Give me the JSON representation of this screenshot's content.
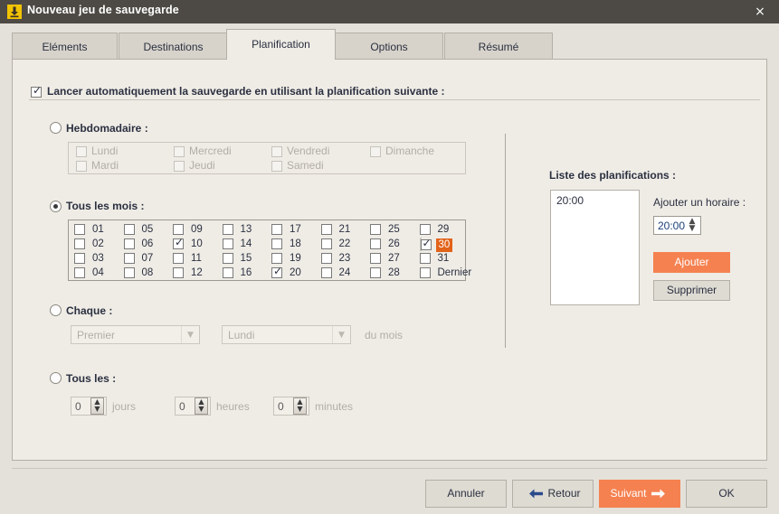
{
  "window": {
    "title": "Nouveau jeu de sauvegarde",
    "icon": "backup-download-icon",
    "close_label": "×",
    "accent_color": "#e2631a",
    "accent_light": "#f58150",
    "titlebar_color": "#4d4a45"
  },
  "tabs": [
    {
      "label": "Eléments",
      "active": false
    },
    {
      "label": "Destinations",
      "active": false
    },
    {
      "label": "Planification",
      "active": true
    },
    {
      "label": "Options",
      "active": false
    },
    {
      "label": "Résumé",
      "active": false
    }
  ],
  "main": {
    "enable_checkbox": {
      "label": "Lancer automatiquement la sauvegarde en utilisant la planification suivante :",
      "checked": true
    },
    "weekly": {
      "radio_label": "Hebdomadaire :",
      "selected": false,
      "enabled": false,
      "days": [
        {
          "label": "Lundi",
          "checked": false
        },
        {
          "label": "Mardi",
          "checked": false
        },
        {
          "label": "Mercredi",
          "checked": false
        },
        {
          "label": "Jeudi",
          "checked": false
        },
        {
          "label": "Vendredi",
          "checked": false
        },
        {
          "label": "Samedi",
          "checked": false
        },
        {
          "label": "Dimanche",
          "checked": false
        }
      ]
    },
    "monthly": {
      "radio_label": "Tous les mois :",
      "selected": true,
      "enabled": true,
      "days": [
        {
          "label": "01",
          "checked": false,
          "highlight": false
        },
        {
          "label": "02",
          "checked": false,
          "highlight": false
        },
        {
          "label": "03",
          "checked": false,
          "highlight": false
        },
        {
          "label": "04",
          "checked": false,
          "highlight": false
        },
        {
          "label": "05",
          "checked": false,
          "highlight": false
        },
        {
          "label": "06",
          "checked": false,
          "highlight": false
        },
        {
          "label": "07",
          "checked": false,
          "highlight": false
        },
        {
          "label": "08",
          "checked": false,
          "highlight": false
        },
        {
          "label": "09",
          "checked": false,
          "highlight": false
        },
        {
          "label": "10",
          "checked": true,
          "highlight": false
        },
        {
          "label": "11",
          "checked": false,
          "highlight": false
        },
        {
          "label": "12",
          "checked": false,
          "highlight": false
        },
        {
          "label": "13",
          "checked": false,
          "highlight": false
        },
        {
          "label": "14",
          "checked": false,
          "highlight": false
        },
        {
          "label": "15",
          "checked": false,
          "highlight": false
        },
        {
          "label": "16",
          "checked": false,
          "highlight": false
        },
        {
          "label": "17",
          "checked": false,
          "highlight": false
        },
        {
          "label": "18",
          "checked": false,
          "highlight": false
        },
        {
          "label": "19",
          "checked": false,
          "highlight": false
        },
        {
          "label": "20",
          "checked": true,
          "highlight": false
        },
        {
          "label": "21",
          "checked": false,
          "highlight": false
        },
        {
          "label": "22",
          "checked": false,
          "highlight": false
        },
        {
          "label": "23",
          "checked": false,
          "highlight": false
        },
        {
          "label": "24",
          "checked": false,
          "highlight": false
        },
        {
          "label": "25",
          "checked": false,
          "highlight": false
        },
        {
          "label": "26",
          "checked": false,
          "highlight": false
        },
        {
          "label": "27",
          "checked": false,
          "highlight": false
        },
        {
          "label": "28",
          "checked": false,
          "highlight": false
        },
        {
          "label": "29",
          "checked": false,
          "highlight": false
        },
        {
          "label": "30",
          "checked": true,
          "highlight": true
        },
        {
          "label": "31",
          "checked": false,
          "highlight": false
        },
        {
          "label": "Dernier",
          "checked": false,
          "highlight": false
        }
      ]
    },
    "each": {
      "radio_label": "Chaque :",
      "selected": false,
      "enabled": false,
      "ordinal_value": "Premier",
      "weekday_value": "Lundi",
      "suffix_label": "du mois"
    },
    "every": {
      "radio_label": "Tous les :",
      "selected": false,
      "enabled": false,
      "fields": [
        {
          "value": "0",
          "unit": "jours"
        },
        {
          "value": "0",
          "unit": "heures"
        },
        {
          "value": "0",
          "unit": "minutes"
        }
      ]
    }
  },
  "schedules": {
    "title": "Liste des planifications :",
    "items": [
      "20:00"
    ],
    "add_time_label": "Ajouter un horaire :",
    "time_value": "20:00",
    "add_button": "Ajouter",
    "remove_button": "Supprimer"
  },
  "footer": {
    "cancel": "Annuler",
    "back": "Retour",
    "next": "Suivant",
    "ok": "OK"
  }
}
